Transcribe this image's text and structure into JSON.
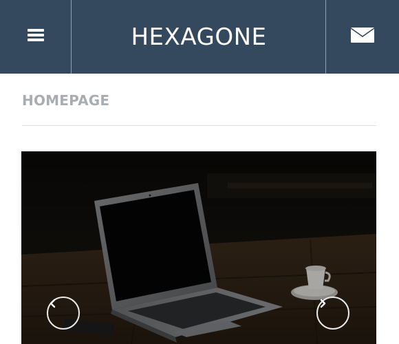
{
  "header": {
    "brand": "HEXAGONE",
    "menu_icon": "hamburger-menu-icon",
    "mail_icon": "envelope-icon",
    "background": "#34495e"
  },
  "page": {
    "heading": "HOMEPAGE"
  },
  "slider": {
    "image": "laptop-on-wooden-table",
    "prev_icon": "chevron-left-icon",
    "next_icon": "chevron-right-icon"
  }
}
